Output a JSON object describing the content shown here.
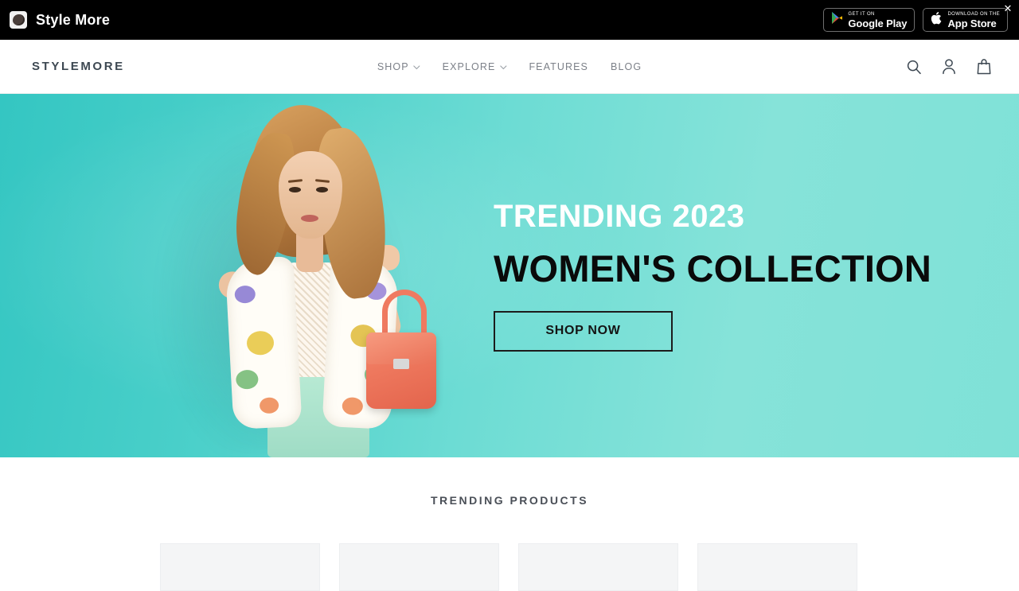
{
  "promo_bar": {
    "app_icon_name": "style-more-app-icon",
    "title": "Style More",
    "badges": [
      {
        "id": "google-play",
        "sup": "GET IT ON",
        "main": "Google Play",
        "icon": "google-play-icon"
      },
      {
        "id": "app-store",
        "sup": "Download on the",
        "main": "App Store",
        "icon": "apple-logo-icon"
      }
    ],
    "close_label": "✕"
  },
  "header": {
    "brand": "STYLEMORE",
    "nav": [
      {
        "label": "SHOP",
        "has_dropdown": true
      },
      {
        "label": "EXPLORE",
        "has_dropdown": true
      },
      {
        "label": "FEATURES",
        "has_dropdown": false
      },
      {
        "label": "BLOG",
        "has_dropdown": false
      }
    ],
    "icons": [
      {
        "name": "search-icon",
        "label": "Search"
      },
      {
        "name": "account-icon",
        "label": "Log in"
      },
      {
        "name": "cart-icon",
        "label": "Cart"
      }
    ]
  },
  "hero": {
    "kicker": "TRENDING 2023",
    "title": "WOMEN'S COLLECTION",
    "cta": "SHOP NOW",
    "colors": {
      "bg_left": "#34c6c2",
      "bg_right": "#7fe1d7",
      "kicker_color": "#ffffff",
      "title_color": "#0a0a0a",
      "cta_border": "#1c1c1c",
      "bag_color": "#ef7a60"
    },
    "image_alt": "Fashion model in floral blazer holding a coral handbag"
  },
  "trending": {
    "heading": "TRENDING PRODUCTS",
    "products": [
      {
        "id": 1,
        "label": ""
      },
      {
        "id": 2,
        "label": ""
      },
      {
        "id": 3,
        "label": ""
      },
      {
        "id": 4,
        "label": ""
      }
    ]
  }
}
